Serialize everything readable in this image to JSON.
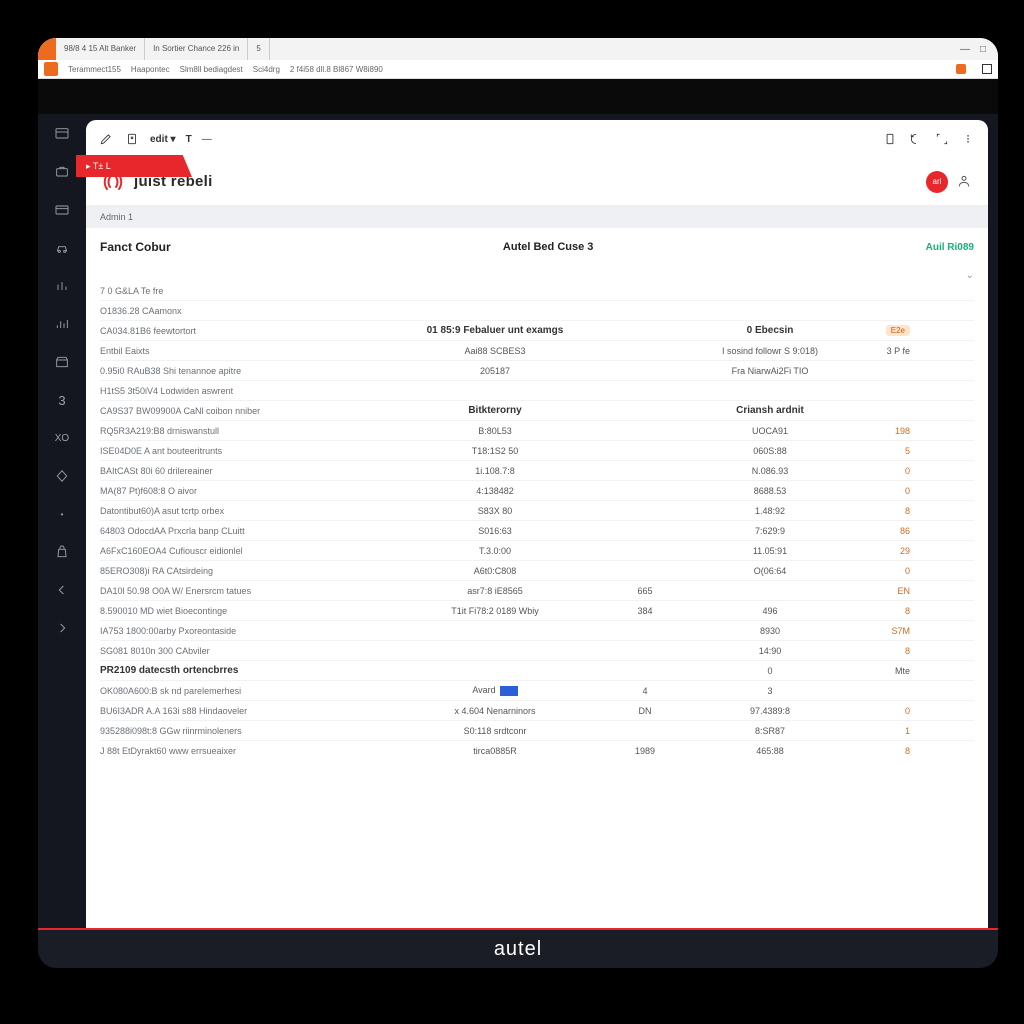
{
  "browser": {
    "tabs": [
      "98/8 4 15 Alt Banker",
      "In Sortier Chance 226 in",
      "5"
    ],
    "address_items": [
      "Terammect155",
      "Haapontec",
      "Slm8ll bediagdest",
      "Sci4drg",
      "2 f4i58 dll.8 Bl867 W8i890"
    ],
    "win_minimize": "—",
    "win_close": "□"
  },
  "red_tab": "▸ T± L",
  "toolbar": {
    "edit_label": "edit ▾",
    "t_label": "T",
    "dash": "—"
  },
  "brand": {
    "name": "juist rebeli",
    "badge": "ari"
  },
  "breadcrumb": "Admin 1",
  "header": {
    "left": "Fanct Cobur",
    "center": "Autel Bed Cuse 3",
    "right": "Auil Ri089"
  },
  "section_headers": {
    "col_a": "01 85:9 Febaluer unt examgs",
    "col_b": "0 Ebecsin",
    "mid_a": "Bitkterorny",
    "mid_b": "Criansh ardnit"
  },
  "badges": {
    "e2e": "E2e",
    "ipfe": "3 P fe"
  },
  "rows": [
    {
      "name": "7 0 G&LA Te fre",
      "a": "",
      "b": "",
      "c": "",
      "d": ""
    },
    {
      "name": "O1836.28 CAamonx",
      "a": "",
      "b": "",
      "c": "",
      "d": ""
    },
    {
      "name": "CA034.81B6 feewtortort",
      "a": "",
      "b": "",
      "c": "",
      "d": ""
    },
    {
      "name": "Entbil Eaixts",
      "a": "Aai88 SCBES3",
      "b": "",
      "c": "I sosind followr S 9:018)",
      "d": ""
    },
    {
      "name": "0.95i0 RAuB38 Shi tenannoe apitre",
      "a": "205187",
      "b": "",
      "c": "Fra NiarwAi2Fi TIO",
      "d": ""
    },
    {
      "name": "H1tS5 3t50iV4 Lodwiden aswrent",
      "a": "",
      "b": "",
      "c": "",
      "d": ""
    },
    {
      "name": "CA9S37 BW09900A CaNl coibon nniber",
      "a": "",
      "b": "",
      "c": "",
      "d": ""
    },
    {
      "name": "RQ5R3A219:B8 drniswanstull",
      "a": "B:80L53",
      "b": "",
      "c": "UOCA91",
      "d": "198"
    },
    {
      "name": "ISE04D0E A ant bouteeritrunts",
      "a": "T18:1S2 50",
      "b": "",
      "c": "060S:88",
      "d": "5"
    },
    {
      "name": "BAItCASt 80i 60 drilereainer",
      "a": "1i.108.7:8",
      "b": "",
      "c": "N.086.93",
      "d": "0"
    },
    {
      "name": "MA(87 Pt)f608:8 O aivor",
      "a": "4:138482",
      "b": "",
      "c": "8688.53",
      "d": "0"
    },
    {
      "name": "Datontibut60)A asut tcrtp orbex",
      "a": "S83X 80",
      "b": "",
      "c": "1.48:92",
      "d": "8"
    },
    {
      "name": "64803 OdocdAA Prxcrla banp CLuitt",
      "a": "S016:63",
      "b": "",
      "c": "7:629:9",
      "d": "86"
    },
    {
      "name": "A6FxC160EOA4 Cufiouscr eidionlel",
      "a": "T.3.0:00",
      "b": "",
      "c": "11.05:91",
      "d": "29"
    },
    {
      "name": "85ERO308)i RA CAtsirdeing",
      "a": "A6t0:C808",
      "b": "",
      "c": "O(06:64",
      "d": "0"
    },
    {
      "name": "DA10l 50.98 O0A W/ Enersrcm tatues",
      "a": "asr7:8 iE8565",
      "b": "665",
      "c": "",
      "d": "EN"
    },
    {
      "name": "8.590010 MD wiet Bioecontinge",
      "a": "T1it Fi78:2 0189 Wbiy",
      "b": "384",
      "c": "496",
      "d": "8"
    },
    {
      "name": "IA753 1800:00arby Pxoreontaside",
      "a": "",
      "b": "",
      "c": "8930",
      "d": "S7M"
    },
    {
      "name": "SG081 8010n 300 CAbviler",
      "a": "",
      "b": "",
      "c": "14:90",
      "d": "8"
    },
    {
      "name": "PR2109 datecsth ortencbrres",
      "a": "",
      "b": "",
      "c": "0",
      "d": "Mte"
    },
    {
      "name": "OK080A600:B sk nd parelemerhesi",
      "a": "Avard",
      "b": "4",
      "c": "3",
      "d": ""
    },
    {
      "name": "BU6I3ADR A.A 163i s88 Hindaoveler",
      "a": "x 4.604 Nenarninors",
      "b": "DN",
      "c": "97.4389:8",
      "d": "0"
    },
    {
      "name": "935288i098t:8 GGw riinrminoleners",
      "a": "S0:118 srdtconr",
      "b": "",
      "c": "8:SR87",
      "d": "1"
    },
    {
      "name": "J 88t EtDyrakt60 www errsueaixer",
      "a": "tirca0885R",
      "b": "1989",
      "c": "465:88",
      "d": "8"
    }
  ],
  "footer": "autel"
}
